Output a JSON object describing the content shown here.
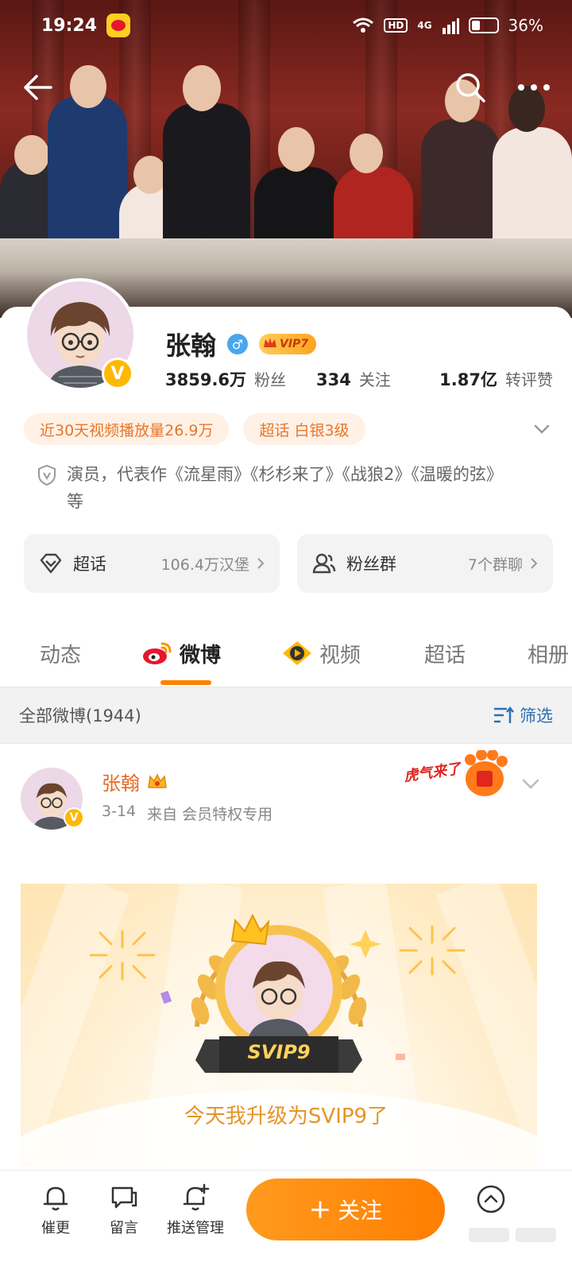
{
  "status_bar": {
    "time": "19:24",
    "hd": "HD",
    "network": "4G",
    "battery": "36%"
  },
  "profile": {
    "name": "张翰",
    "gender_symbol": "♂",
    "vip_label": "VIP7",
    "verify_symbol": "V",
    "stats": [
      {
        "num": "3859.6万",
        "label": "粉丝"
      },
      {
        "num": "334",
        "label": "关注"
      },
      {
        "num": "1.87亿",
        "label": "转评赞"
      }
    ],
    "tags": [
      "近30天视频播放量26.9万",
      "超话 白银3级"
    ],
    "bio": "演员，代表作《流星雨》《杉杉来了》《战狼2》《温暖的弦》等",
    "cards": [
      {
        "title": "超话",
        "sub": "106.4万汉堡"
      },
      {
        "title": "粉丝群",
        "sub": "7个群聊"
      }
    ]
  },
  "tabs": [
    {
      "label": "动态"
    },
    {
      "label": "微博"
    },
    {
      "label": "视频"
    },
    {
      "label": "超话"
    },
    {
      "label": "相册"
    }
  ],
  "filter": {
    "title": "全部微博(1944)",
    "button": "筛选"
  },
  "post": {
    "author": "张翰",
    "date": "3-14",
    "source": "来自 会员特权专用",
    "sticker_text": "虎气来了",
    "svip_badge": "SVIP9",
    "caption": "今天我升级为SVIP9了"
  },
  "bottom_bar": {
    "items": [
      "催更",
      "留言",
      "推送管理"
    ],
    "follow": "关注",
    "follow_plus": "+"
  },
  "colors": {
    "accent": "#ff8200",
    "orange_text": "#e86a24",
    "link_blue": "#2d6fb3",
    "verify_gold": "#ffb800",
    "gender_blue": "#49a6ef"
  }
}
